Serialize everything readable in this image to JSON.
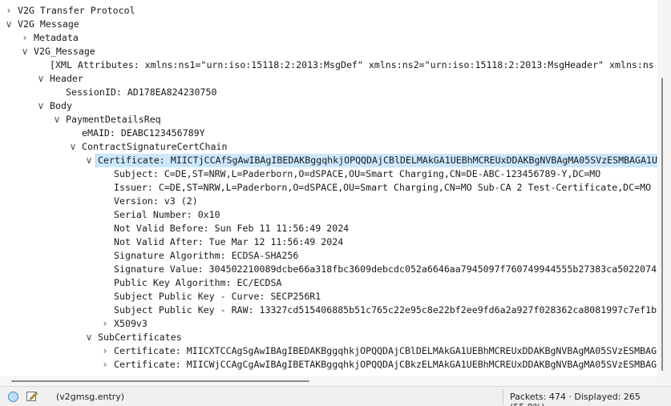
{
  "tree": [
    {
      "label": "V2G Transfer Protocol",
      "indent": 0,
      "toggle": "collapsed"
    },
    {
      "label": "V2G Message",
      "indent": 0,
      "toggle": "expanded"
    },
    {
      "label": "Metadata",
      "indent": 1,
      "toggle": "collapsed"
    },
    {
      "label": "V2G_Message",
      "indent": 1,
      "toggle": "expanded"
    },
    {
      "label": "[XML Attributes:  xmlns:ns1=\"urn:iso:15118:2:2013:MsgDef\" xmlns:ns2=\"urn:iso:15118:2:2013:MsgHeader\" xmlns:ns",
      "indent": 2,
      "toggle": "none"
    },
    {
      "label": "Header",
      "indent": 2,
      "toggle": "expanded"
    },
    {
      "label": "SessionID: AD178EA824230750",
      "indent": 3,
      "toggle": "none"
    },
    {
      "label": "Body",
      "indent": 2,
      "toggle": "expanded"
    },
    {
      "label": "PaymentDetailsReq",
      "indent": 3,
      "toggle": "expanded"
    },
    {
      "label": "eMAID: DEABC123456789Y",
      "indent": 4,
      "toggle": "none"
    },
    {
      "label": "ContractSignatureCertChain",
      "indent": 4,
      "toggle": "expanded"
    },
    {
      "label": "Certificate: MIICTjCCAfSgAwIBAgIBEDAKBggqhkjOPQQDAjCBlDELMAkGA1UEBhMCREUxDDAKBgNVBAgMA05SVzESMBAGA1U",
      "indent": 5,
      "toggle": "expanded",
      "selected": true
    },
    {
      "label": "Subject: C=DE,ST=NRW,L=Paderborn,O=dSPACE,OU=Smart Charging,CN=DE-ABC-123456789-Y,DC=MO",
      "indent": 6,
      "toggle": "none"
    },
    {
      "label": "Issuer: C=DE,ST=NRW,L=Paderborn,O=dSPACE,OU=Smart Charging,CN=MO Sub-CA 2 Test-Certificate,DC=MO",
      "indent": 6,
      "toggle": "none"
    },
    {
      "label": "Version: v3 (2)",
      "indent": 6,
      "toggle": "none"
    },
    {
      "label": "Serial Number: 0x10",
      "indent": 6,
      "toggle": "none"
    },
    {
      "label": "Not Valid Before: Sun Feb 11 11:56:49 2024",
      "indent": 6,
      "toggle": "none"
    },
    {
      "label": "Not Valid After: Tue Mar 12 11:56:49 2024",
      "indent": 6,
      "toggle": "none"
    },
    {
      "label": "Signature Algorithm: ECDSA-SHA256",
      "indent": 6,
      "toggle": "none"
    },
    {
      "label": "Signature Value: 304502210089dcbe66a318fbc3609debcdc052a6646aa7945097f760749944555b27383ca5022074",
      "indent": 6,
      "toggle": "none"
    },
    {
      "label": "Public Key Algorithm: EC/ECDSA",
      "indent": 6,
      "toggle": "none"
    },
    {
      "label": "Subject Public Key - Curve: SECP256R1",
      "indent": 6,
      "toggle": "none"
    },
    {
      "label": "Subject Public Key - RAW: 13327cd515406885b51c765c22e95c8e22bf2ee9fd6a2a927f028362ca8081997c7ef1b",
      "indent": 6,
      "toggle": "none"
    },
    {
      "label": "X509v3",
      "indent": 6,
      "toggle": "collapsed"
    },
    {
      "label": "SubCertificates",
      "indent": 5,
      "toggle": "expanded"
    },
    {
      "label": "Certificate: MIICXTCCAgSgAwIBAgIBEDAKBggqhkjOPQQDAjCBlDELMAkGA1UEBhMCREUxDDAKBgNVBAgMA05SVzESMBAG",
      "indent": 6,
      "toggle": "collapsed"
    },
    {
      "label": "Certificate: MIICWjCCAgCgAwIBAgIBETAKBggqhkjOPQQDAjCBkzELMAkGA1UEBhMCREUxDDAKBgNVBAgMA05SVzESMBAG",
      "indent": 6,
      "toggle": "collapsed"
    }
  ],
  "status": {
    "filter_text": "(v2gmsg.entry)",
    "packets_text": "Packets: 474 · Displayed: 265 (55.9%)",
    "status_icon": "circle-icon",
    "edit_icon": "edit-pencil-icon"
  },
  "colors": {
    "selection": "#cce8ff",
    "accent": "#3a8fc7"
  }
}
